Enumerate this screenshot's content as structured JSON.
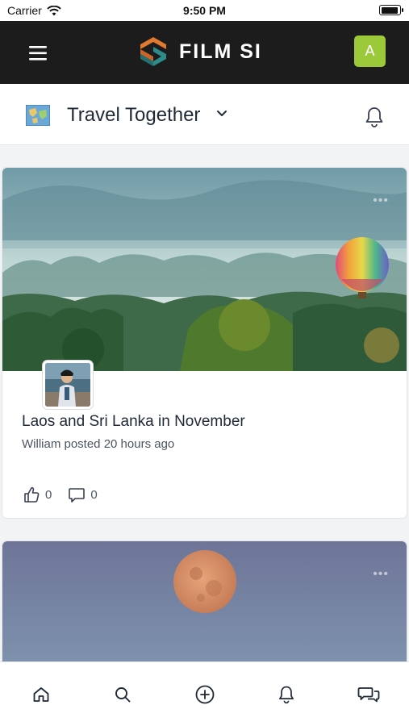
{
  "status_bar": {
    "carrier": "Carrier",
    "time": "9:50 PM",
    "icons": [
      "wifi-icon",
      "battery-icon"
    ]
  },
  "header": {
    "menu_icon": "hamburger-menu-icon",
    "logo_text": "FILM SI",
    "avatar_initial": "A",
    "colors": {
      "background": "#1c1c1c",
      "avatar": "#9cc93a",
      "logo_orange": "#e07a2f",
      "logo_teal": "#2e8b8b"
    }
  },
  "community": {
    "name": "Travel Together",
    "dropdown_icon": "chevron-down-icon",
    "notification_icon": "bell-icon",
    "icon": "map-icon"
  },
  "posts": [
    {
      "image": "misty-forest-hot-air-balloon",
      "title": "Laos and Sri Lanka in November",
      "meta": "William posted 20 hours ago",
      "likes": "0",
      "comments": "0",
      "more_icon": "more-dots-icon"
    },
    {
      "image": "full-moon-dusk-sky",
      "more_icon": "more-dots-icon"
    }
  ],
  "bottom_nav": [
    {
      "name": "home",
      "icon": "home-icon"
    },
    {
      "name": "search",
      "icon": "search-icon"
    },
    {
      "name": "create",
      "icon": "plus-circle-icon"
    },
    {
      "name": "notifications",
      "icon": "bell-icon"
    },
    {
      "name": "messages",
      "icon": "chat-icon"
    }
  ]
}
